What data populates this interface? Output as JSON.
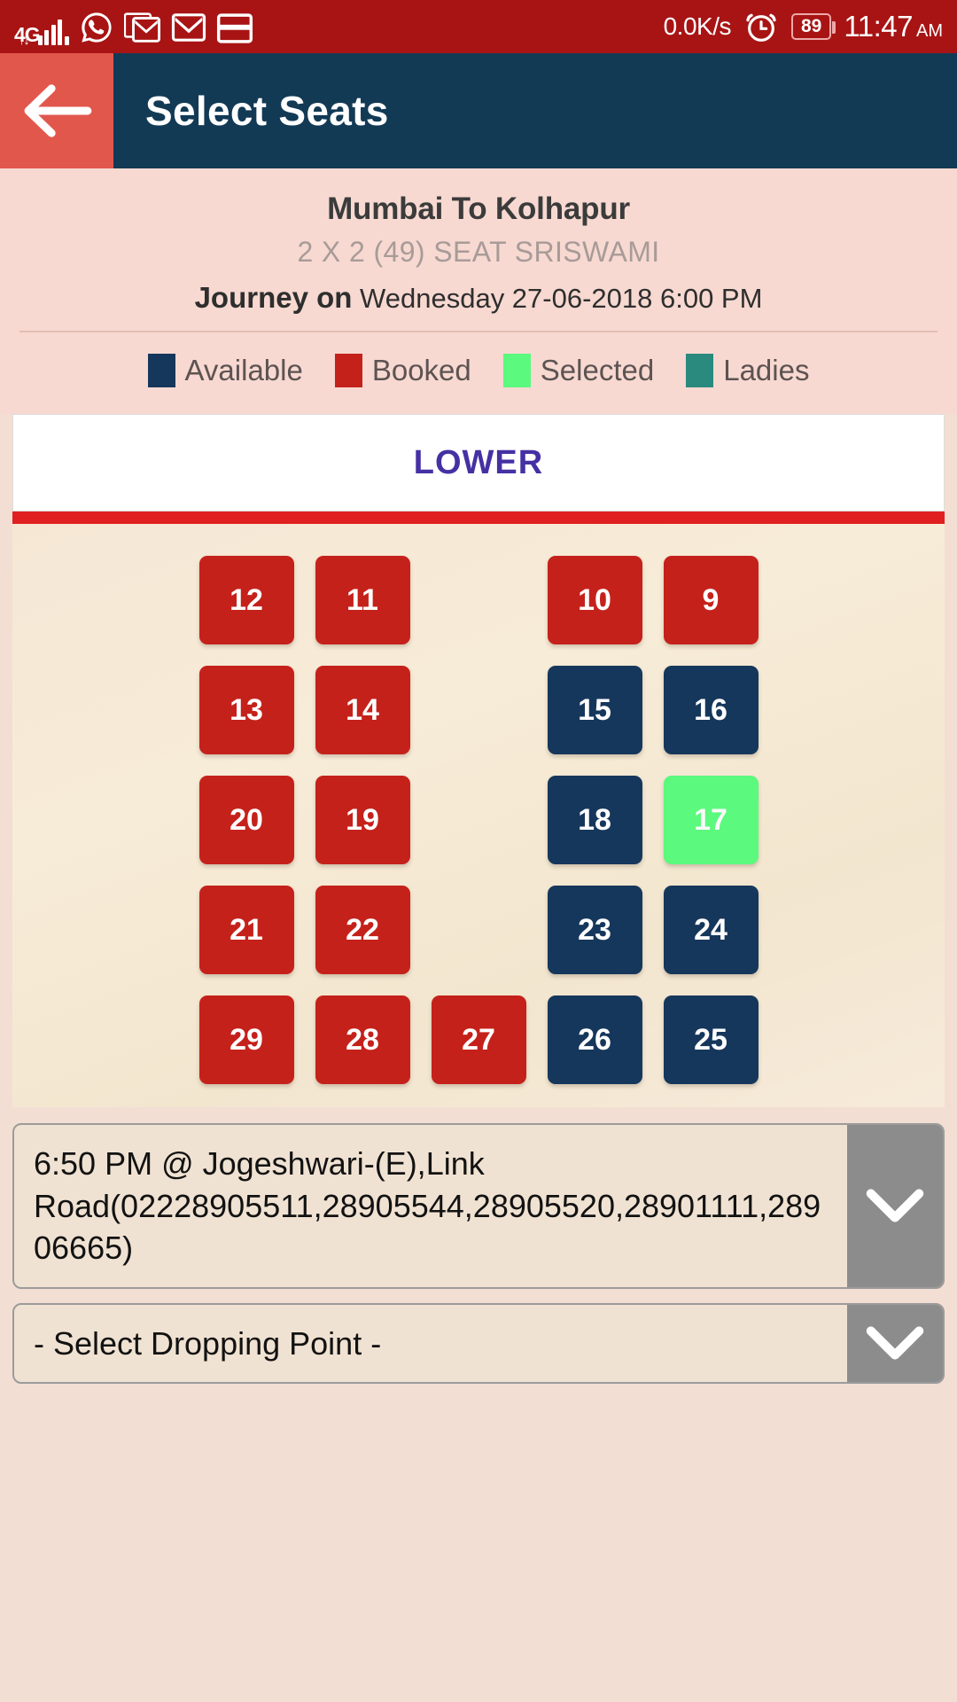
{
  "statusbar": {
    "network_label": "4G",
    "network_arrows": "↑↓",
    "icons": [
      "signal-bars-icon",
      "whatsapp-icon",
      "gmail-icon",
      "gmail-icon",
      "card-icon"
    ],
    "data_speed": "0.0K/s",
    "alarm_icon": "alarm-clock-icon",
    "battery_level": "89",
    "time": "11:47",
    "am_pm": "AM"
  },
  "appbar": {
    "back_icon": "back-arrow-icon",
    "title": "Select Seats"
  },
  "trip": {
    "route": "Mumbai To Kolhapur",
    "bus_type": "2 X 2 (49) SEAT SRISWAMI",
    "journey_prefix": "Journey on",
    "journey_details": "Wednesday 27-06-2018  6:00 PM"
  },
  "legend": [
    {
      "label": "Available",
      "color": "#16375c"
    },
    {
      "label": "Booked",
      "color": "#c5211b"
    },
    {
      "label": "Selected",
      "color": "#5bf97d"
    },
    {
      "label": "Ladies",
      "color": "#2a8a7e"
    }
  ],
  "deck": {
    "title": "LOWER"
  },
  "seat_map": {
    "rows": [
      [
        {
          "number": "12",
          "state": "booked"
        },
        {
          "number": "11",
          "state": "booked"
        },
        {
          "number": "",
          "state": "aisle"
        },
        {
          "number": "10",
          "state": "booked"
        },
        {
          "number": "9",
          "state": "booked"
        }
      ],
      [
        {
          "number": "13",
          "state": "booked"
        },
        {
          "number": "14",
          "state": "booked"
        },
        {
          "number": "",
          "state": "aisle"
        },
        {
          "number": "15",
          "state": "available"
        },
        {
          "number": "16",
          "state": "available"
        }
      ],
      [
        {
          "number": "20",
          "state": "booked"
        },
        {
          "number": "19",
          "state": "booked"
        },
        {
          "number": "",
          "state": "aisle"
        },
        {
          "number": "18",
          "state": "available"
        },
        {
          "number": "17",
          "state": "selected"
        }
      ],
      [
        {
          "number": "21",
          "state": "booked"
        },
        {
          "number": "22",
          "state": "booked"
        },
        {
          "number": "",
          "state": "aisle"
        },
        {
          "number": "23",
          "state": "available"
        },
        {
          "number": "24",
          "state": "available"
        }
      ],
      [
        {
          "number": "29",
          "state": "booked"
        },
        {
          "number": "28",
          "state": "booked"
        },
        {
          "number": "27",
          "state": "booked"
        },
        {
          "number": "26",
          "state": "available"
        },
        {
          "number": "25",
          "state": "available"
        }
      ]
    ]
  },
  "boarding_point": {
    "value": "6:50 PM @ Jogeshwari-(E),Link Road(02228905511,28905544,28905520,28901111,28906665)",
    "arrow_icon": "chevron-down-icon"
  },
  "dropping_point": {
    "value": "- Select Dropping Point -",
    "arrow_icon": "chevron-down-icon"
  },
  "colors": {
    "status_bar": "#a81414",
    "back_button": "#e2574c",
    "app_bar": "#123a55",
    "trip_bg": "#f7d9d1",
    "deck_title": "#4531a3",
    "deck_bar": "#e02020"
  }
}
